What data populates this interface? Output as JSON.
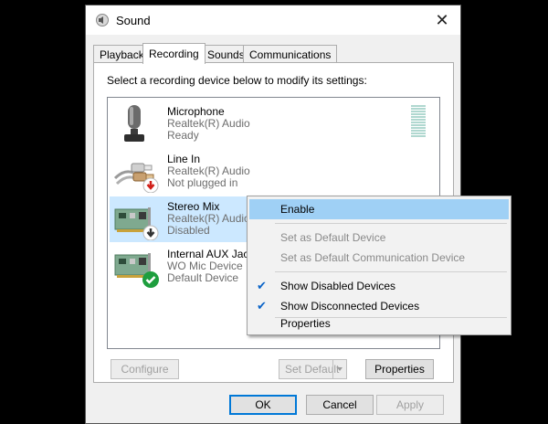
{
  "window": {
    "title": "Sound",
    "close_glyph": "✕"
  },
  "tabs": [
    {
      "label": "Playback"
    },
    {
      "label": "Recording"
    },
    {
      "label": "Sounds"
    },
    {
      "label": "Communications"
    }
  ],
  "instructions": "Select a recording device below to modify its settings:",
  "devices": [
    {
      "name": "Microphone",
      "driver": "Realtek(R) Audio",
      "status": "Ready"
    },
    {
      "name": "Line In",
      "driver": "Realtek(R) Audio",
      "status": "Not plugged in"
    },
    {
      "name": "Stereo Mix",
      "driver": "Realtek(R) Audio",
      "status": "Disabled"
    },
    {
      "name": "Internal AUX Jack",
      "driver": "WO Mic Device",
      "status": "Default Device"
    }
  ],
  "buttons": {
    "configure": "Configure",
    "set_default": "Set Default",
    "properties": "Properties",
    "ok": "OK",
    "cancel": "Cancel",
    "apply": "Apply"
  },
  "context_menu": [
    {
      "label": "Enable"
    },
    {
      "label": "Set as Default Device"
    },
    {
      "label": "Set as Default Communication Device"
    },
    {
      "label": "Show Disabled Devices",
      "checked": true
    },
    {
      "label": "Show Disconnected Devices",
      "checked": true
    },
    {
      "label": "Properties"
    }
  ],
  "check_glyph": "✔",
  "colors": {
    "selection": "#cce8ff",
    "menu_highlight": "#9fd0f5",
    "accent": "#0078d7"
  }
}
